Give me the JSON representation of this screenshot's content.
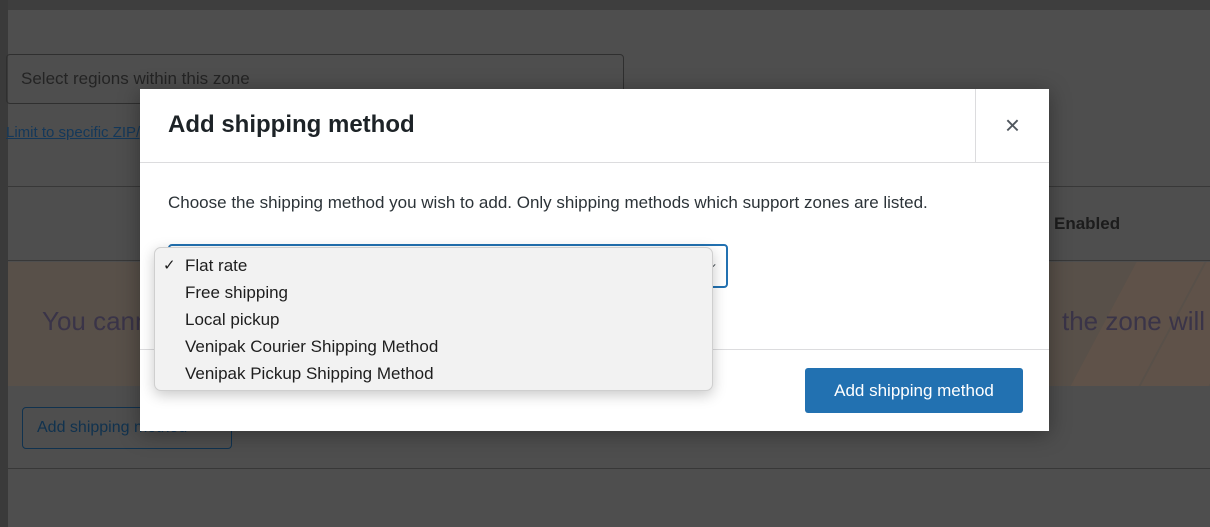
{
  "background": {
    "region_placeholder": "Select regions within this zone",
    "limit_link": "Limit to specific ZIP/postcodes",
    "enabled_header": "Enabled",
    "notice_left": "You cannot add shipping methods",
    "notice_right": "the zone will s",
    "add_button": "Add shipping method"
  },
  "modal": {
    "title": "Add shipping method",
    "close_symbol": "×",
    "description": "Choose the shipping method you wish to add. Only shipping methods which support zones are listed.",
    "select_arrow": "⌄",
    "submit_label": "Add shipping method"
  },
  "dropdown": {
    "check_mark": "✓",
    "options": [
      {
        "label": "Flat rate",
        "selected": true
      },
      {
        "label": "Free shipping",
        "selected": false
      },
      {
        "label": "Local pickup",
        "selected": false
      },
      {
        "label": "Venipak Courier Shipping Method",
        "selected": false
      },
      {
        "label": "Venipak Pickup Shipping Method",
        "selected": false
      }
    ]
  },
  "colors": {
    "overlay": "#4e4e4e",
    "primary": "#2271b1",
    "modal_bg": "#ffffff",
    "dropdown_bg": "#f2f2f2"
  }
}
